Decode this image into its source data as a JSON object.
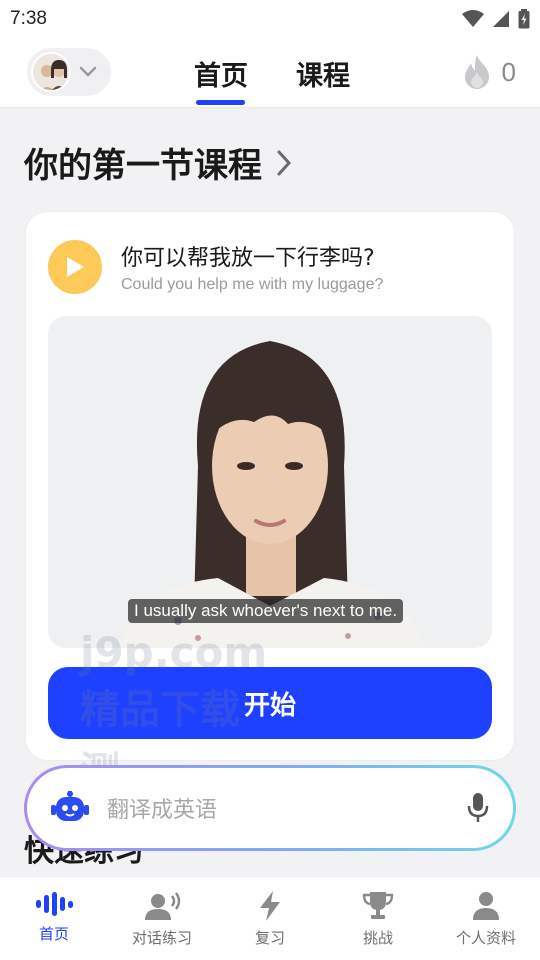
{
  "status_bar": {
    "time": "7:38"
  },
  "header": {
    "tabs": [
      {
        "label": "首页"
      },
      {
        "label": "课程"
      }
    ],
    "streak_count": "0"
  },
  "section": {
    "title": "你的第一节课程"
  },
  "lesson": {
    "title_cn": "你可以帮我放一下行李吗?",
    "title_en": "Could you help me with my luggage?",
    "video_subtitle": "I usually ask whoever's next to me.",
    "start_label": "开始"
  },
  "next_section_title": "快速练习",
  "translate": {
    "placeholder": "翻译成英语"
  },
  "watermark": {
    "line1": "j9p.com",
    "line2": "精品下载",
    "line3": "测"
  },
  "bottom_nav": {
    "items": [
      {
        "label": "首页",
        "icon": "voice-wave-icon",
        "active": true
      },
      {
        "label": "对话练习",
        "icon": "speaking-person-icon"
      },
      {
        "label": "复习",
        "icon": "lightning-icon"
      },
      {
        "label": "挑战",
        "icon": "trophy-icon"
      },
      {
        "label": "个人资料",
        "icon": "person-icon"
      }
    ]
  },
  "colors": {
    "accent": "#1e40ff",
    "play": "#ffc95a"
  }
}
